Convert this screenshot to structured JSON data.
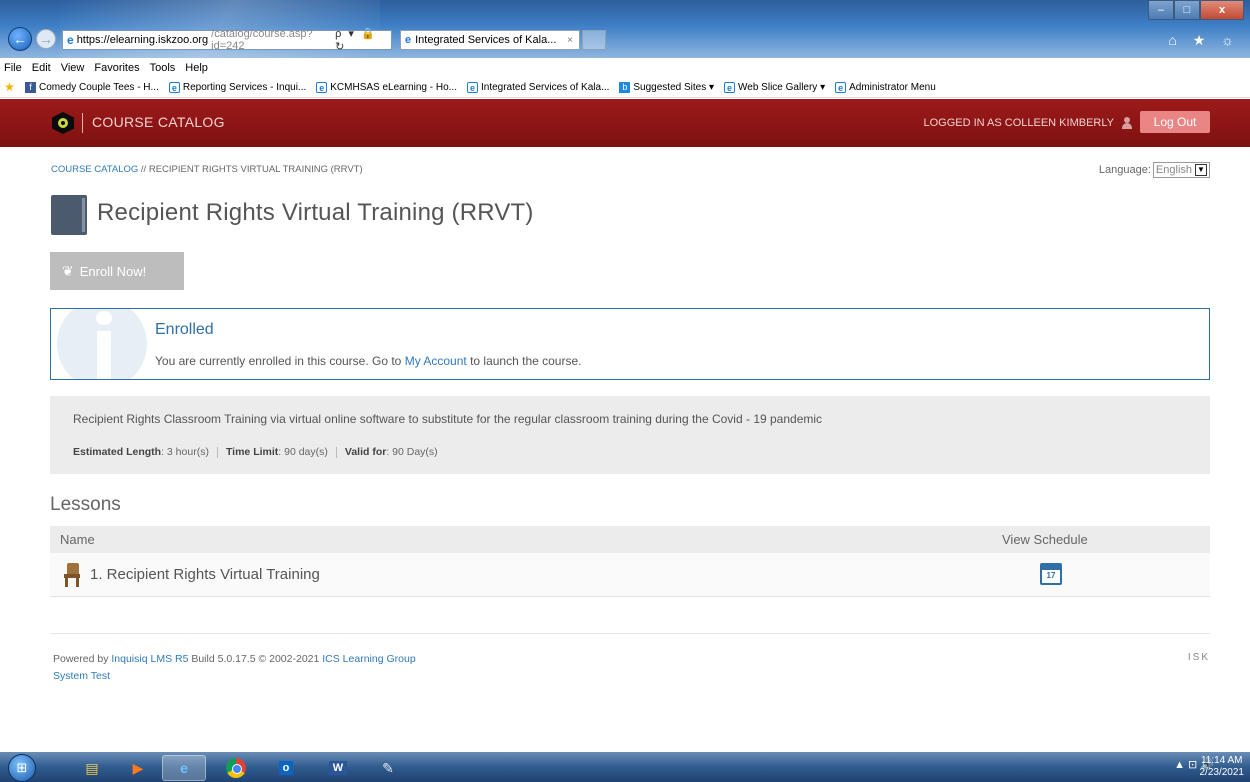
{
  "browser": {
    "url_host": "https://elearning.iskzoo.org",
    "url_path": "/catalog/course.asp?id=242",
    "address_tools": "ρ ▾ 🔒 ↻",
    "tab_title": "Integrated Services of Kala...",
    "tab_close": "×",
    "win_min": "–",
    "win_max": "□",
    "win_close": "x",
    "right_tools": "⌂ ★ ☼",
    "menu": [
      "File",
      "Edit",
      "View",
      "Favorites",
      "Tools",
      "Help"
    ],
    "favorites": [
      {
        "label": "Comedy Couple Tees - H...",
        "icon": "facebook-icon"
      },
      {
        "label": "Reporting Services - Inqui...",
        "icon": "ie-page-icon"
      },
      {
        "label": "KCMHSAS eLearning - Ho...",
        "icon": "ie-page-icon"
      },
      {
        "label": "Integrated Services of Kala...",
        "icon": "ie-page-icon"
      },
      {
        "label": "Suggested Sites ▾",
        "icon": "bing-icon"
      },
      {
        "label": "Web Slice Gallery ▾",
        "icon": "ie-page-icon"
      },
      {
        "label": "Administrator Menu",
        "icon": "ie-page-icon"
      }
    ]
  },
  "header": {
    "catalog_title": "COURSE CATALOG",
    "logged_in": "LOGGED IN AS COLLEEN KIMBERLY",
    "logout": "Log Out",
    "accent_color": "#8b1515"
  },
  "breadcrumb": {
    "root": "COURSE CATALOG",
    "separator": " // ",
    "current": "RECIPIENT RIGHTS VIRTUAL TRAINING (RRVT)"
  },
  "language": {
    "label": "Language:",
    "selected": "English"
  },
  "course": {
    "title": "Recipient Rights Virtual Training (RRVT)",
    "enroll_button": "Enroll Now!",
    "enrolled_title": "Enrolled",
    "enrolled_msg_before": "You are currently enrolled in this course. Go to ",
    "enrolled_msg_link": "My Account",
    "enrolled_msg_after": " to launch the course.",
    "description": "Recipient Rights Classroom Training via virtual online software to substitute for the regular classroom training during the Covid - 19 pandemic",
    "meta": {
      "length_label": "Estimated Length",
      "length_value": ": 3 hour(s)",
      "limit_label": "Time Limit",
      "limit_value": ": 90 day(s)",
      "valid_label": "Valid for",
      "valid_value": ": 90 Day(s)"
    }
  },
  "lessons": {
    "heading": "Lessons",
    "columns": {
      "name": "Name",
      "schedule": "View Schedule"
    },
    "rows": [
      {
        "name": "1. Recipient Rights Virtual Training",
        "calendar_day": "17"
      }
    ]
  },
  "footer": {
    "powered_by": "Powered by ",
    "product_link": "Inquisiq LMS R5",
    "build": " Build 5.0.17.5  © 2002-2021  ",
    "company_link": "ICS Learning Group",
    "system_link": "System Test",
    "right_text": "ISK"
  },
  "taskbar": {
    "tray": "▲  ⊡  🔊",
    "time": "11:14 AM",
    "date": "2/23/2021"
  }
}
